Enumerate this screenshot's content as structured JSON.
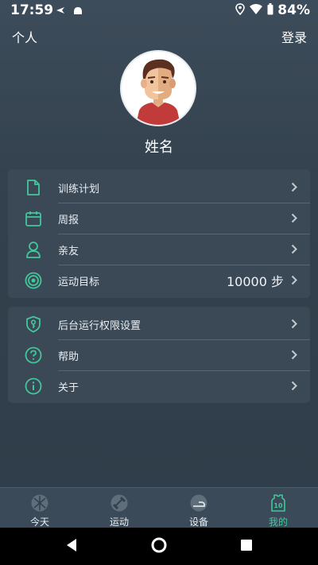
{
  "status_bar": {
    "time": "17:59",
    "battery": "84%",
    "icons": [
      "airplane-sync-icon",
      "android-icon",
      "location-icon",
      "wifi-icon",
      "battery-icon"
    ]
  },
  "header": {
    "title": "个人",
    "login_label": "登录"
  },
  "profile": {
    "name": "姓名",
    "avatar": "avatar-icon"
  },
  "menu_primary": [
    {
      "label": "训练计划",
      "icon": "document-icon"
    },
    {
      "label": "周报",
      "icon": "calendar-icon"
    },
    {
      "label": "亲友",
      "icon": "person-icon"
    },
    {
      "label": "运动目标",
      "icon": "target-icon",
      "value": "10000 步"
    }
  ],
  "menu_secondary": [
    {
      "label": "后台运行权限设置",
      "icon": "shield-key-icon"
    },
    {
      "label": "帮助",
      "icon": "help-icon"
    },
    {
      "label": "关于",
      "icon": "info-icon"
    }
  ],
  "bottom_nav": [
    {
      "label": "今天",
      "icon": "today-icon"
    },
    {
      "label": "运动",
      "icon": "dumbbell-icon"
    },
    {
      "label": "设备",
      "icon": "device-icon"
    },
    {
      "label": "我的",
      "icon": "jersey-icon",
      "active": true,
      "badge": "10"
    }
  ],
  "colors": {
    "accent": "#41c79a",
    "background": "#33414e",
    "card": "#3b4957"
  }
}
